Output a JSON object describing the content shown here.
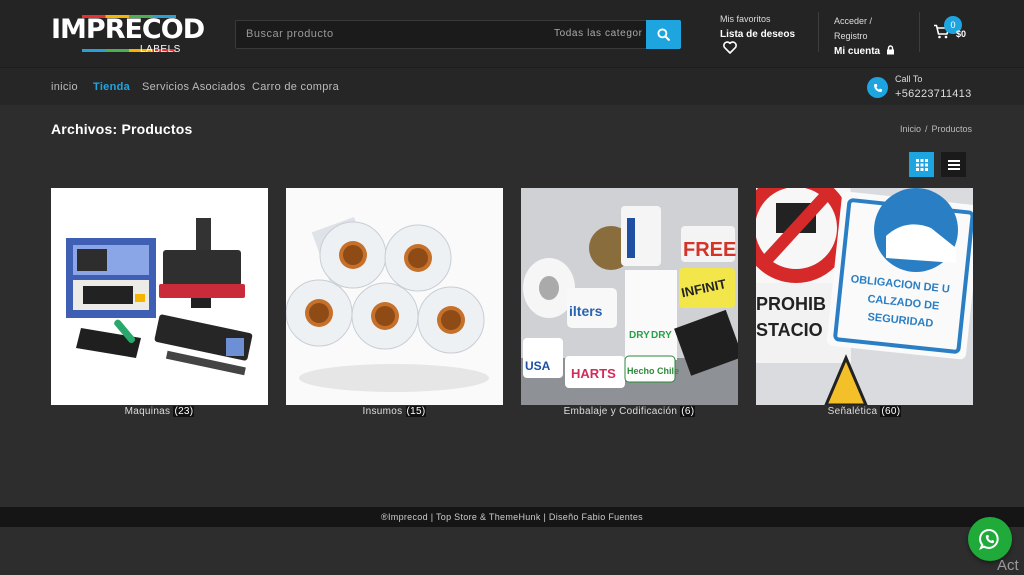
{
  "header": {
    "logo_main": "IMPRECOD",
    "logo_sub": "LABELS",
    "search_placeholder": "Buscar producto",
    "search_category": "Todas las categor",
    "favorites_small": "Mis favoritos",
    "favorites_big": "Lista de deseos",
    "account_line1": "Acceder /",
    "account_line2": "Registro",
    "account_big": "Mi cuenta",
    "cart_count": "0",
    "cart_total": "$0"
  },
  "nav": {
    "items": [
      "inicio",
      "Tienda",
      "Servicios Asociados",
      "Carro de compra"
    ],
    "active": "Tienda",
    "call_label": "Call To",
    "call_phone": "+56223711413"
  },
  "main": {
    "title": "Archivos: Productos",
    "breadcrumb": [
      "Inicio",
      "Productos"
    ],
    "categories": [
      {
        "name": "Maquinas",
        "count": "(23)"
      },
      {
        "name": "Insumos",
        "count": "(15)"
      },
      {
        "name": "Embalaje y Codificación",
        "count": "(6)"
      },
      {
        "name": "Señalética",
        "count": "(60)"
      }
    ],
    "image_texts": {
      "free": "FREE",
      "infinit": "INFINIT",
      "filters": "ilters",
      "usa": "USA",
      "hearts": "HARTS",
      "chile": "Hecho Chile",
      "dry": "DRY",
      "prohib": "PROHIB",
      "stacio": "STACIO",
      "sign": [
        "OBLIGACION DE U",
        "CALZADO DE",
        "SEGURIDAD"
      ]
    }
  },
  "footer": {
    "text": "®Imprecod | Top Store & ThemeHunk | Diseño Fabio Fuentes"
  },
  "overlay": {
    "activate": "Act"
  },
  "colors": {
    "accent": "#1ea5e0",
    "whatsapp": "#1faa3a",
    "background": "#2d2d2d"
  },
  "icons": [
    "search-icon",
    "heart-icon",
    "lock-icon",
    "cart-icon",
    "phone-icon",
    "grid-view-icon",
    "list-view-icon",
    "whatsapp-icon"
  ]
}
